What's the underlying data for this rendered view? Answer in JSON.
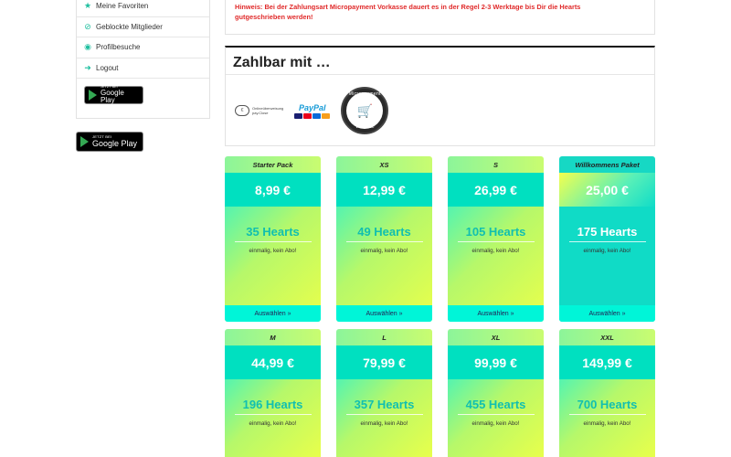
{
  "sidebar": {
    "items": [
      {
        "label": "Meine Favoriten",
        "icon": "star-icon"
      },
      {
        "label": "Geblockte Mitglieder",
        "icon": "block-icon"
      },
      {
        "label": "Profilbesuche",
        "icon": "eye-icon"
      },
      {
        "label": "Logout",
        "icon": "logout-icon"
      }
    ],
    "google_play": {
      "small": "JETZT BEI",
      "big": "Google Play"
    }
  },
  "google_play_outer": {
    "small": "JETZT BEI",
    "big": "Google Play"
  },
  "notice": {
    "line1": "Hinweis: Bei der Zahlungsart Micropayment Vorkasse dauert es in der Regel 2-3 Werktage bis Dir die Hearts",
    "line2": "gutgeschrieben werden!"
  },
  "payment": {
    "title": "Zahlbar mit …",
    "onlineueberweisung": {
      "line1": "Onlineüberweisung",
      "line2": "pay.Close"
    },
    "paypal": {
      "pay": "Pay",
      "pal": "Pal"
    },
    "vorkasse": {
      "top": "Micropayment",
      "bottom": "Vorkasse"
    }
  },
  "packages": [
    {
      "name": "Starter Pack",
      "price": "8,99 €",
      "hearts": "35 Hearts",
      "note": "einmalig, kein Abo!",
      "select": "Auswählen »",
      "style": "normal"
    },
    {
      "name": "XS",
      "price": "12,99 €",
      "hearts": "49 Hearts",
      "note": "einmalig, kein Abo!",
      "select": "Auswählen »",
      "style": "normal"
    },
    {
      "name": "S",
      "price": "26,99 €",
      "hearts": "105 Hearts",
      "note": "einmalig, kein Abo!",
      "select": "Auswählen »",
      "style": "normal"
    },
    {
      "name": "Willkommens Paket",
      "price": "25,00 €",
      "hearts": "175 Hearts",
      "note": "einmalig, kein Abo!",
      "select": "Auswählen »",
      "style": "special"
    },
    {
      "name": "M",
      "price": "44,99 €",
      "hearts": "196 Hearts",
      "note": "einmalig, kein Abo!",
      "select": "Auswählen »",
      "style": "normal"
    },
    {
      "name": "L",
      "price": "79,99 €",
      "hearts": "357 Hearts",
      "note": "einmalig, kein Abo!",
      "select": "Auswählen »",
      "style": "normal"
    },
    {
      "name": "XL",
      "price": "99,99 €",
      "hearts": "455 Hearts",
      "note": "einmalig, kein Abo!",
      "select": "Auswählen »",
      "style": "normal"
    },
    {
      "name": "XXL",
      "price": "149,99 €",
      "hearts": "700 Hearts",
      "note": "einmalig, kein Abo!",
      "select": "Auswählen »",
      "style": "normal"
    }
  ],
  "colors": {
    "accent": "#1fbf9f",
    "notice": "#e02a2a",
    "select_bg": "#00f5d8"
  }
}
